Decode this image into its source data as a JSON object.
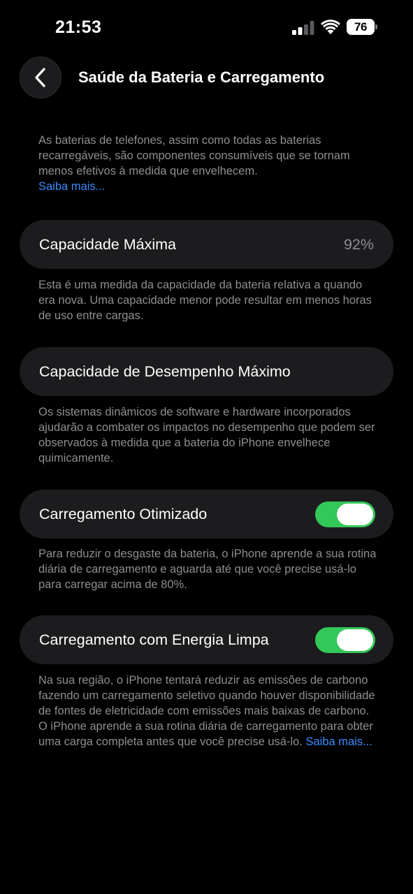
{
  "status_bar": {
    "time": "21:53",
    "battery_level": "76"
  },
  "nav": {
    "title": "Saúde da Bateria e Carregamento"
  },
  "intro": {
    "text": "As baterias de telefones, assim como todas as baterias recarregáveis, são componentes consumíveis que se tornam menos efetivos à medida que envelhecem.",
    "link": "Saiba mais..."
  },
  "max_capacity": {
    "label": "Capacidade Máxima",
    "value": "92%",
    "description": "Esta é uma medida da capacidade da bateria relativa a quando era nova. Uma capacidade menor pode resultar em menos horas de uso entre cargas."
  },
  "peak_performance": {
    "label": "Capacidade de Desempenho Máximo",
    "description": "Os sistemas dinâmicos de software e hardware incorporados ajudarão a combater os impactos no desempenho que podem ser observados à medida que a bateria do iPhone envelhece quimicamente."
  },
  "optimized_charging": {
    "label": "Carregamento Otimizado",
    "enabled": true,
    "description": "Para reduzir o desgaste da bateria, o iPhone aprende a sua rotina diária de carregamento e aguarda até que você precise usá-lo para carregar acima de 80%."
  },
  "clean_energy": {
    "label": "Carregamento com Energia Limpa",
    "enabled": true,
    "description": "Na sua região, o iPhone tentará reduzir as emissões de carbono fazendo um carregamento seletivo quando houver disponibilidade de fontes de eletricidade com emissões mais baixas de carbono. O iPhone aprende a sua rotina diária de carregamento para obter uma carga completa antes que você precise usá-lo.",
    "link": "Saiba mais..."
  },
  "colors": {
    "background": "#000000",
    "cell": "#1c1c1e",
    "toggle_on": "#34c759",
    "link": "#3a8cff",
    "secondary_text": "#8e8e93"
  },
  "icons": [
    "cellular-signal-icon",
    "wifi-icon",
    "battery-icon",
    "chevron-left-icon"
  ]
}
